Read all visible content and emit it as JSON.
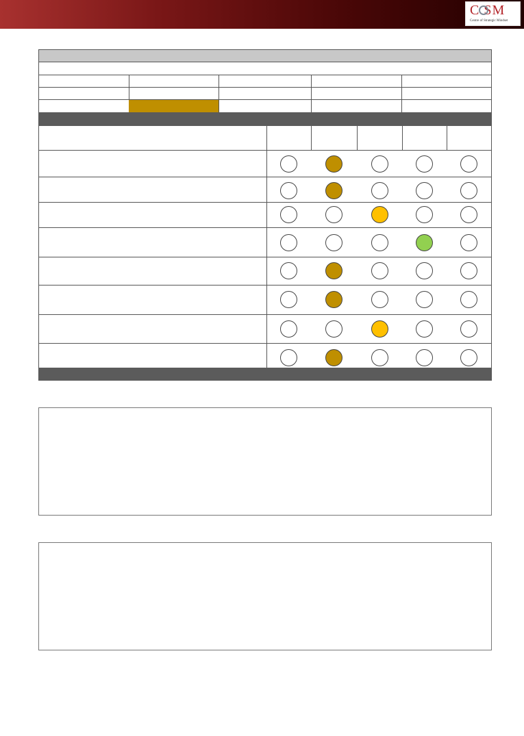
{
  "header": {
    "logo_text": "C  SM",
    "logo_subtitle": "Centre of Strategic Mindset",
    "colors": {
      "banner_start": "#a8312f",
      "banner_end": "#220000",
      "logo_red": "#b4252a"
    }
  },
  "form": {
    "title": "",
    "subtitle": "",
    "info_rows": [
      [
        "",
        "",
        "",
        "",
        ""
      ],
      [
        "",
        "",
        "",
        "",
        ""
      ],
      [
        "",
        "",
        "",
        "",
        ""
      ]
    ],
    "highlighted_cell": {
      "row": 2,
      "col": 1,
      "color": "#bf8f00"
    },
    "section_title": "",
    "criteria_header": "",
    "rating_headers": [
      "",
      "",
      "",
      "",
      ""
    ],
    "rating_scale": 5,
    "criteria": [
      {
        "label": "",
        "selected": 2,
        "color": "#bf8f00"
      },
      {
        "label": "",
        "selected": 2,
        "color": "#bf8f00"
      },
      {
        "label": "",
        "selected": 3,
        "color": "#ffc000"
      },
      {
        "label": "",
        "selected": 4,
        "color": "#92d050"
      },
      {
        "label": "",
        "selected": 2,
        "color": "#bf8f00"
      },
      {
        "label": "",
        "selected": 2,
        "color": "#bf8f00"
      },
      {
        "label": "",
        "selected": 3,
        "color": "#ffc000"
      },
      {
        "label": "",
        "selected": 2,
        "color": "#bf8f00"
      }
    ],
    "footer_text": ""
  },
  "comments": [
    {
      "label": "",
      "body": ""
    },
    {
      "label": "",
      "body": ""
    }
  ]
}
